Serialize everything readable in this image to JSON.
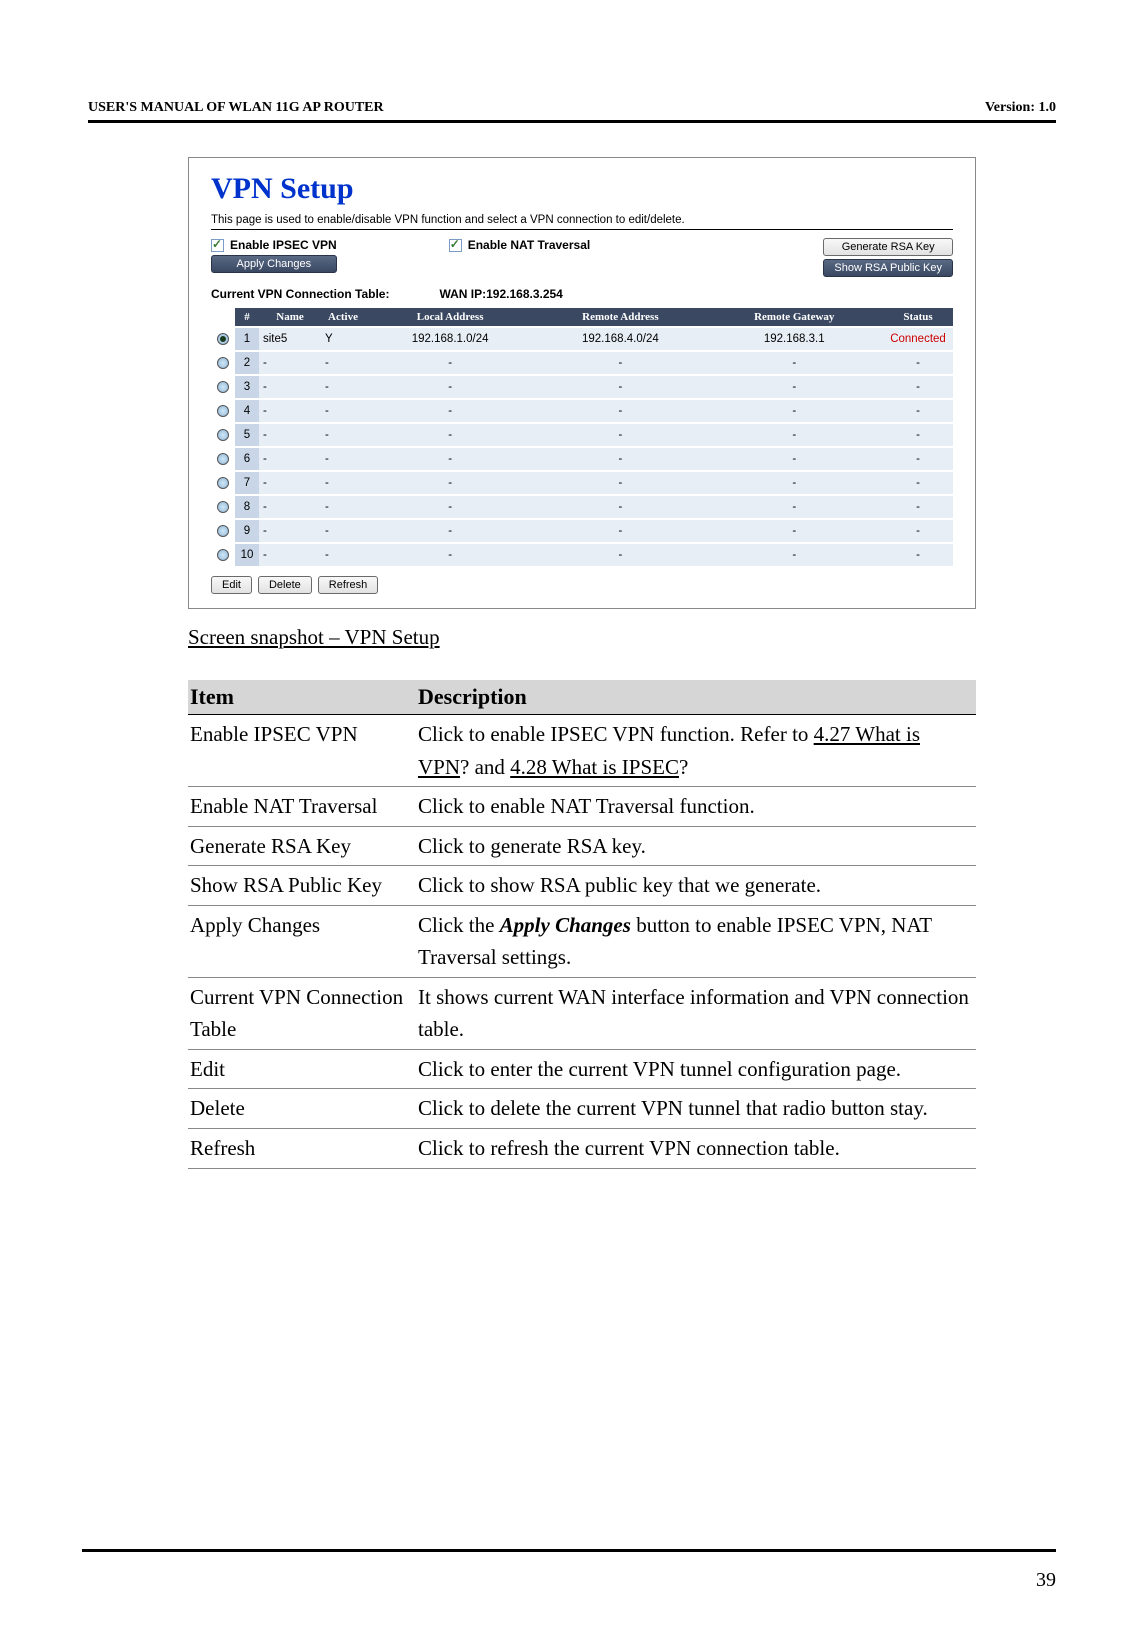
{
  "header": {
    "left": "USER'S MANUAL OF WLAN 11G AP ROUTER",
    "right": "Version: 1.0"
  },
  "screenshot": {
    "title": "VPN Setup",
    "subtitle": "This page is used to enable/disable VPN function and select a VPN connection to edit/delete.",
    "enable_ipsec_vpn": "Enable IPSEC VPN",
    "enable_nat_traversal": "Enable NAT Traversal",
    "generate_rsa_key": "Generate RSA Key",
    "show_rsa_public_key": "Show RSA Public Key",
    "apply_changes": "Apply Changes",
    "table_label": "Current VPN Connection Table:",
    "wan_ip_label": "WAN IP:192.168.3.254",
    "headers": {
      "num": "#",
      "name": "Name",
      "active": "Active",
      "local_addr": "Local Address",
      "remote_addr": "Remote Address",
      "remote_gw": "Remote Gateway",
      "status": "Status"
    },
    "rows": [
      {
        "selected": true,
        "num": "1",
        "name": "site5",
        "active": "Y",
        "local": "192.168.1.0/24",
        "remote": "192.168.4.0/24",
        "gateway": "192.168.3.1",
        "status": "Connected"
      },
      {
        "selected": false,
        "num": "2",
        "name": "-",
        "active": "-",
        "local": "-",
        "remote": "-",
        "gateway": "-",
        "status": "-"
      },
      {
        "selected": false,
        "num": "3",
        "name": "-",
        "active": "-",
        "local": "-",
        "remote": "-",
        "gateway": "-",
        "status": "-"
      },
      {
        "selected": false,
        "num": "4",
        "name": "-",
        "active": "-",
        "local": "-",
        "remote": "-",
        "gateway": "-",
        "status": "-"
      },
      {
        "selected": false,
        "num": "5",
        "name": "-",
        "active": "-",
        "local": "-",
        "remote": "-",
        "gateway": "-",
        "status": "-"
      },
      {
        "selected": false,
        "num": "6",
        "name": "-",
        "active": "-",
        "local": "-",
        "remote": "-",
        "gateway": "-",
        "status": "-"
      },
      {
        "selected": false,
        "num": "7",
        "name": "-",
        "active": "-",
        "local": "-",
        "remote": "-",
        "gateway": "-",
        "status": "-"
      },
      {
        "selected": false,
        "num": "8",
        "name": "-",
        "active": "-",
        "local": "-",
        "remote": "-",
        "gateway": "-",
        "status": "-"
      },
      {
        "selected": false,
        "num": "9",
        "name": "-",
        "active": "-",
        "local": "-",
        "remote": "-",
        "gateway": "-",
        "status": "-"
      },
      {
        "selected": false,
        "num": "10",
        "name": "-",
        "active": "-",
        "local": "-",
        "remote": "-",
        "gateway": "-",
        "status": "-"
      }
    ],
    "edit": "Edit",
    "delete": "Delete",
    "refresh": "Refresh"
  },
  "caption": "Screen snapshot – VPN Setup",
  "desc": {
    "header_item": "Item",
    "header_desc": "Description",
    "rows": [
      {
        "item": "Enable IPSEC VPN",
        "desc_pre": "Click to enable IPSEC VPN function. Refer to ",
        "link1": "4.27 What is VPN",
        "mid": "? and ",
        "link2": "4.28 What is IPSEC",
        "post": "?"
      },
      {
        "item": "Enable NAT Traversal",
        "desc": "Click to enable NAT Traversal function."
      },
      {
        "item": "Generate RSA Key",
        "desc": "Click to generate RSA key."
      },
      {
        "item": "Show RSA Public Key",
        "desc": "Click to show RSA public key that we generate."
      },
      {
        "item": "Apply Changes",
        "desc_pre": "Click the ",
        "emph": "Apply Changes",
        "desc_post": " button to enable IPSEC VPN, NAT Traversal settings."
      },
      {
        "item": "Current VPN Connection Table",
        "desc": "It shows current WAN interface information and VPN connection table."
      },
      {
        "item": "Edit",
        "desc": "Click to enter the current VPN tunnel configuration page."
      },
      {
        "item": "Delete",
        "desc": "Click to delete the current VPN tunnel that radio button stay."
      },
      {
        "item": "Refresh",
        "desc": "Click to refresh the current VPN connection table."
      }
    ]
  },
  "page_number": "39"
}
